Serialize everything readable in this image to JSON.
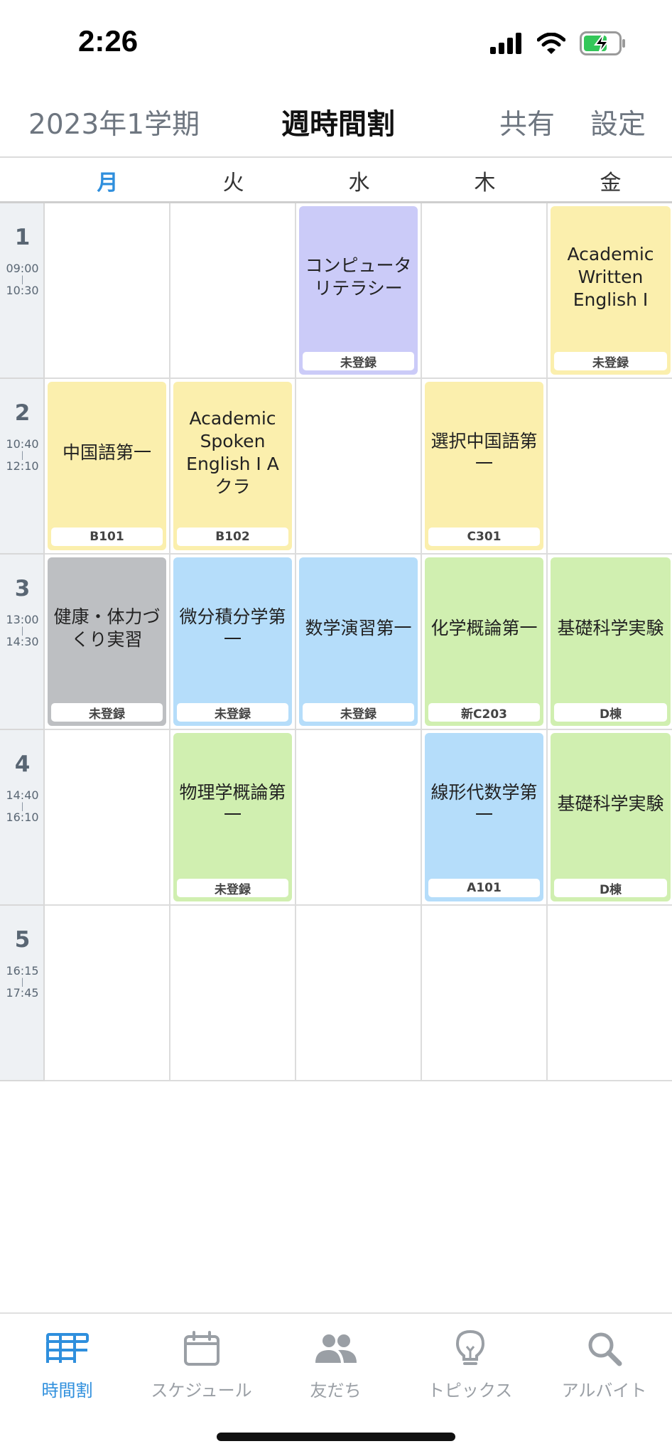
{
  "status_bar": {
    "time": "2:26"
  },
  "header": {
    "term": "2023年1学期",
    "title": "週時間割",
    "share": "共有",
    "settings": "設定"
  },
  "days": [
    "月",
    "火",
    "水",
    "木",
    "金"
  ],
  "active_day_index": 0,
  "periods": [
    {
      "num": "1",
      "start": "09:00",
      "end": "10:30"
    },
    {
      "num": "2",
      "start": "10:40",
      "end": "12:10"
    },
    {
      "num": "3",
      "start": "13:00",
      "end": "14:30"
    },
    {
      "num": "4",
      "start": "14:40",
      "end": "16:10"
    },
    {
      "num": "5",
      "start": "16:15",
      "end": "17:45"
    }
  ],
  "courses": {
    "p1_wed": {
      "name": "コンピュータリテラシー",
      "room": "未登録",
      "color": "#cbcbf8"
    },
    "p1_fri": {
      "name": "Academic Written English I",
      "room": "未登録",
      "color": "#fbefad"
    },
    "p2_mon": {
      "name": "中国語第一",
      "room": "B101",
      "color": "#fbefad"
    },
    "p2_tue": {
      "name": "Academic Spoken English I A クラ",
      "room": "B102",
      "color": "#fbefad"
    },
    "p2_thu": {
      "name": "選択中国語第一",
      "room": "C301",
      "color": "#fbefad"
    },
    "p3_mon": {
      "name": "健康・体力づくり実習",
      "room": "未登録",
      "color": "#bdbfc2"
    },
    "p3_tue": {
      "name": "微分積分学第一",
      "room": "未登録",
      "color": "#b5ddfa"
    },
    "p3_wed": {
      "name": "数学演習第一",
      "room": "未登録",
      "color": "#b5ddfa"
    },
    "p3_thu": {
      "name": "化学概論第一",
      "room": "新C203",
      "color": "#d0efb0"
    },
    "p3_fri": {
      "name": "基礎科学実験",
      "room": "D棟",
      "color": "#d0efb0"
    },
    "p4_tue": {
      "name": "物理学概論第一",
      "room": "未登録",
      "color": "#d0efb0"
    },
    "p4_thu": {
      "name": "線形代数学第一",
      "room": "A101",
      "color": "#b5ddfa"
    },
    "p4_fri": {
      "name": "基礎科学実験",
      "room": "D棟",
      "color": "#d0efb0"
    }
  },
  "tabs": [
    {
      "label": "時間割",
      "icon": "timetable-icon",
      "active": true
    },
    {
      "label": "スケジュール",
      "icon": "calendar-icon",
      "active": false
    },
    {
      "label": "友だち",
      "icon": "friends-icon",
      "active": false
    },
    {
      "label": "トピックス",
      "icon": "lightbulb-icon",
      "active": false
    },
    {
      "label": "アルバイト",
      "icon": "search-icon",
      "active": false
    }
  ],
  "colors": {
    "accent": "#2f8fdd",
    "inactive": "#9a9fa5"
  }
}
